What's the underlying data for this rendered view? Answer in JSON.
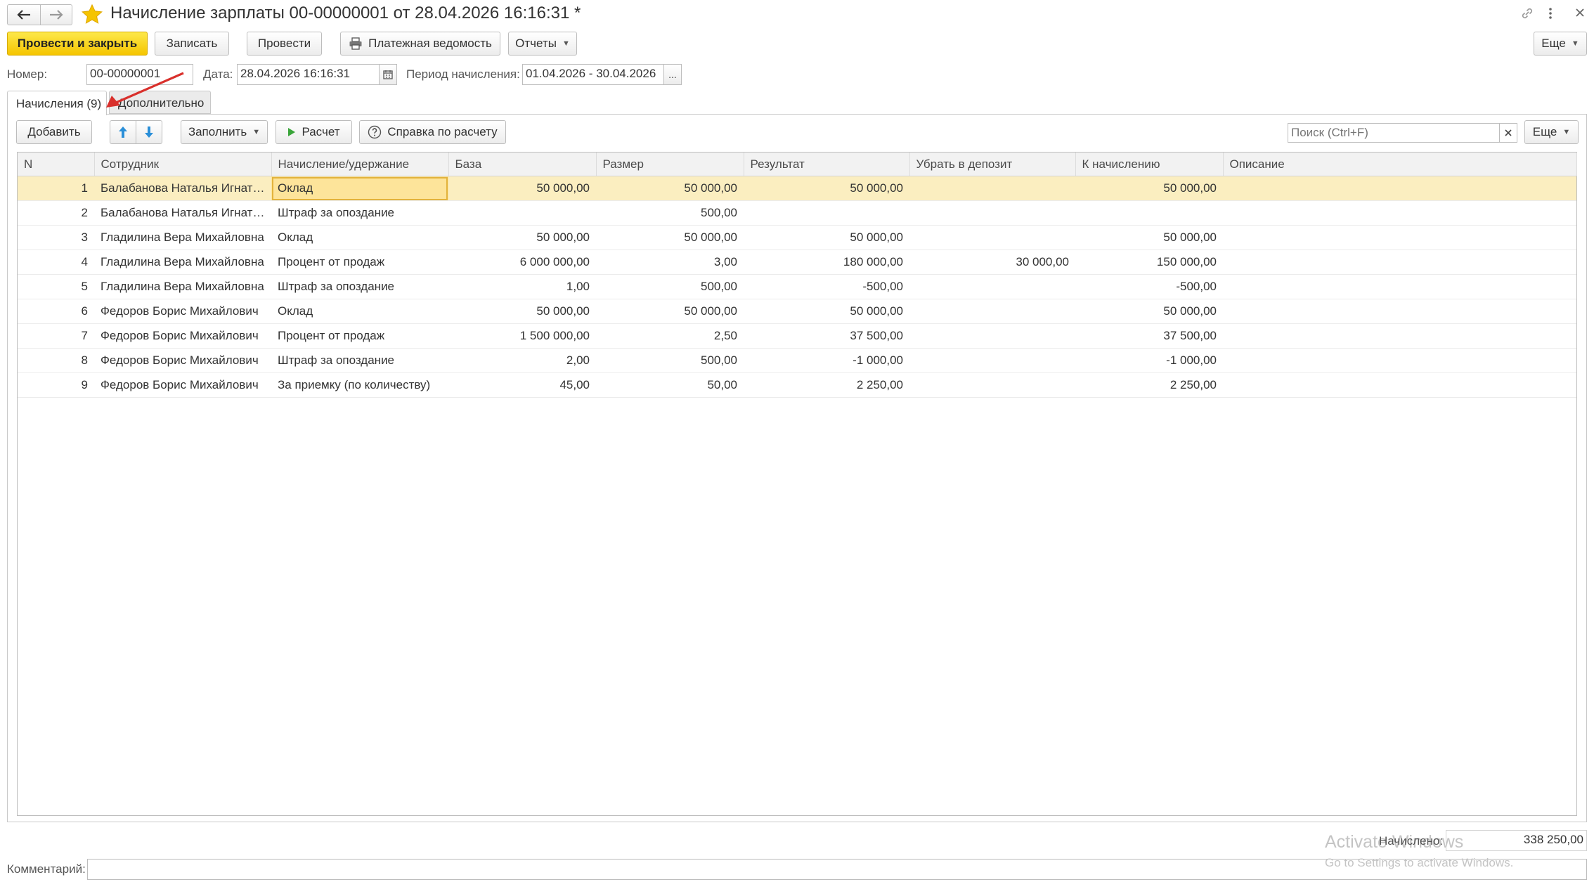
{
  "window": {
    "title": "Начисление зарплаты 00-00000001 от 28.04.2026 16:16:31 *"
  },
  "toolbar": {
    "post_and_close": "Провести и закрыть",
    "save": "Записать",
    "post": "Провести",
    "payroll_sheet": "Платежная ведомость",
    "reports": "Отчеты",
    "more": "Еще"
  },
  "header": {
    "number_label": "Номер:",
    "number_value": "00-00000001",
    "date_label": "Дата:",
    "date_value": "28.04.2026 16:16:31",
    "period_label": "Период начисления:",
    "period_value": "01.04.2026 - 30.04.2026",
    "period_button": "..."
  },
  "tabs": [
    {
      "label": "Начисления (9)",
      "active": true
    },
    {
      "label": "Дополнительно",
      "active": false
    }
  ],
  "table_toolbar": {
    "add": "Добавить",
    "fill": "Заполнить",
    "calculate": "Расчет",
    "help": "Справка по расчету",
    "search_placeholder": "Поиск (Ctrl+F)",
    "more": "Еще"
  },
  "table": {
    "columns": [
      "N",
      "Сотрудник",
      "Начисление/удержание",
      "База",
      "Размер",
      "Результат",
      "Убрать в депозит",
      "К начислению",
      "Описание"
    ],
    "rows": [
      {
        "n": "1",
        "employee": "Балабанова Наталья Игнатьевна",
        "type": "Оклад",
        "base": "50 000,00",
        "size": "50 000,00",
        "result": "50 000,00",
        "deposit": "",
        "accrue": "50 000,00",
        "desc": ""
      },
      {
        "n": "2",
        "employee": "Балабанова Наталья Игнатьевна",
        "type": "Штраф за опоздание",
        "base": "",
        "size": "500,00",
        "result": "",
        "deposit": "",
        "accrue": "",
        "desc": ""
      },
      {
        "n": "3",
        "employee": "Гладилина Вера Михайловна",
        "type": "Оклад",
        "base": "50 000,00",
        "size": "50 000,00",
        "result": "50 000,00",
        "deposit": "",
        "accrue": "50 000,00",
        "desc": ""
      },
      {
        "n": "4",
        "employee": "Гладилина Вера Михайловна",
        "type": "Процент от продаж",
        "base": "6 000 000,00",
        "size": "3,00",
        "result": "180 000,00",
        "deposit": "30 000,00",
        "accrue": "150 000,00",
        "desc": ""
      },
      {
        "n": "5",
        "employee": "Гладилина Вера Михайловна",
        "type": "Штраф за опоздание",
        "base": "1,00",
        "size": "500,00",
        "result": "-500,00",
        "deposit": "",
        "accrue": "-500,00",
        "desc": ""
      },
      {
        "n": "6",
        "employee": "Федоров Борис Михайлович",
        "type": "Оклад",
        "base": "50 000,00",
        "size": "50 000,00",
        "result": "50 000,00",
        "deposit": "",
        "accrue": "50 000,00",
        "desc": ""
      },
      {
        "n": "7",
        "employee": "Федоров Борис Михайлович",
        "type": "Процент от продаж",
        "base": "1 500 000,00",
        "size": "2,50",
        "result": "37 500,00",
        "deposit": "",
        "accrue": "37 500,00",
        "desc": ""
      },
      {
        "n": "8",
        "employee": "Федоров Борис Михайлович",
        "type": "Штраф за опоздание",
        "base": "2,00",
        "size": "500,00",
        "result": "-1 000,00",
        "deposit": "",
        "accrue": "-1 000,00",
        "desc": ""
      },
      {
        "n": "9",
        "employee": "Федоров Борис Михайлович",
        "type": "За приемку (по количеству)",
        "base": "45,00",
        "size": "50,00",
        "result": "2 250,00",
        "deposit": "",
        "accrue": "2 250,00",
        "desc": ""
      }
    ]
  },
  "footer": {
    "total_label": "Начислено:",
    "total_value": "338 250,00",
    "comment_label": "Комментарий:",
    "comment_value": "",
    "watermark_line1": "Activate Windows",
    "watermark_line2": "Go to Settings to activate Windows."
  },
  "colors": {
    "primary_button": "#f5c500",
    "selected_row": "#fbeec0",
    "annotation_arrow": "#d9302c",
    "favorite_star": "#f5c400",
    "arrow_icons": "#2a8fd8"
  }
}
